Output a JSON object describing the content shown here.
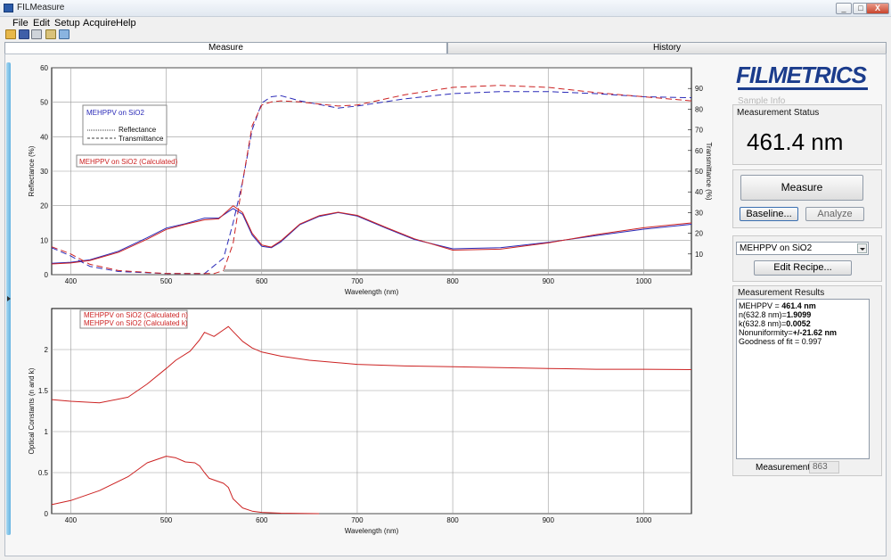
{
  "window": {
    "title": "FILMeasure",
    "btn_min": "_",
    "btn_max": "□",
    "btn_close": "X"
  },
  "menu": [
    "File",
    "Edit",
    "Setup",
    "Acquire",
    "Help"
  ],
  "toolbar_icons": [
    "open-folder-icon",
    "save-icon",
    "print-icon",
    "recipe-icon",
    "copy-icon"
  ],
  "tabs": {
    "measure": "Measure",
    "history": "History"
  },
  "brand": {
    "logo": "FILMETRICS",
    "color": "#1b3c8c"
  },
  "side": {
    "sample_info": "Sample Info",
    "status_label": "Measurement Status",
    "status_value": "461.4 nm",
    "measure_btn": "Measure",
    "baseline_btn": "Baseline...",
    "analyze_btn": "Analyze",
    "recipe_selected": "MEHPPV on SiO2",
    "edit_recipe_btn": "Edit Recipe...",
    "results_label": "Measurement Results",
    "results": {
      "l1a": "MEHPPV = ",
      "l1b": "461.4 nm",
      "l2a": " n(632.8 nm)=",
      "l2b": "1.9099",
      "l3a": " k(632.8 nm)=",
      "l3b": "0.0052",
      "l4a": " Nonuniformity=",
      "l4b": "+/-21.62 nm",
      "l5": " Goodness of fit = 0.997"
    },
    "meas_num_label": "Measurement #",
    "meas_num": "863"
  },
  "chart_data": [
    {
      "type": "line",
      "xlabel": "Wavelength (nm)",
      "ylabel": "Reflectance (%)",
      "y2label": "Transmittance (%)",
      "xlim": [
        380,
        1050
      ],
      "ylim": [
        0,
        60
      ],
      "y2lim": [
        0,
        100
      ],
      "xticks": [
        400,
        500,
        600,
        700,
        800,
        900,
        1000
      ],
      "yticks": [
        0,
        10,
        20,
        30,
        40,
        50,
        60
      ],
      "y2ticks": [
        10,
        20,
        30,
        40,
        50,
        60,
        70,
        80,
        90
      ],
      "legend": {
        "box1_title": "MEHPPV on SiO2",
        "box1_line1": "Reflectance",
        "box1_line2": "Transmittance",
        "box2_title": "MEHPPV on SiO2 (Calculated)"
      },
      "colors": {
        "measured": "#2a2ab8",
        "calculated": "#cc2222"
      },
      "series": [
        {
          "name": "Reflectance",
          "axis": "left",
          "style": "solid",
          "x": [
            380,
            400,
            420,
            450,
            480,
            500,
            520,
            540,
            555,
            570,
            580,
            590,
            600,
            610,
            620,
            640,
            660,
            680,
            700,
            730,
            760,
            800,
            850,
            900,
            950,
            1000,
            1050
          ],
          "y": [
            3.3,
            3.6,
            4.3,
            6.8,
            10.7,
            13.5,
            14.8,
            16.4,
            16.4,
            19.2,
            17.5,
            11.5,
            8.2,
            7.8,
            9.5,
            14.5,
            16.9,
            18,
            17,
            13.5,
            10.2,
            7.5,
            7.8,
            9.4,
            11.3,
            13.2,
            14.6
          ]
        },
        {
          "name": "Reflectance (Calculated)",
          "axis": "left",
          "style": "solid",
          "x": [
            380,
            400,
            420,
            450,
            480,
            500,
            520,
            540,
            555,
            570,
            580,
            590,
            600,
            610,
            620,
            640,
            660,
            680,
            700,
            730,
            760,
            800,
            850,
            900,
            950,
            1000,
            1050
          ],
          "y": [
            3.1,
            3.4,
            4.1,
            6.5,
            10.3,
            13.1,
            14.6,
            15.9,
            16.2,
            20,
            18,
            12,
            8.6,
            8,
            9.8,
            14.7,
            17.1,
            18.1,
            17.2,
            13.7,
            10.4,
            7.1,
            7.4,
            9.2,
            11.6,
            13.6,
            15
          ]
        },
        {
          "name": "Transmittance",
          "axis": "right",
          "style": "dashed",
          "x": [
            380,
            400,
            420,
            450,
            500,
            540,
            560,
            570,
            580,
            590,
            600,
            610,
            620,
            640,
            680,
            700,
            750,
            800,
            850,
            900,
            950,
            1000,
            1050
          ],
          "y": [
            13,
            9,
            4,
            1.5,
            0.5,
            0.5,
            8,
            25,
            45,
            70,
            83,
            86,
            86.5,
            84,
            80.5,
            81.5,
            85,
            87.5,
            88.5,
            88.5,
            87.5,
            86,
            85.5
          ]
        },
        {
          "name": "Transmittance (Calculated)",
          "axis": "right",
          "style": "dashed",
          "x": [
            380,
            400,
            420,
            450,
            500,
            550,
            560,
            570,
            580,
            590,
            600,
            610,
            620,
            640,
            680,
            700,
            750,
            800,
            850,
            900,
            950,
            1000,
            1050
          ],
          "y": [
            13.5,
            10,
            5,
            2,
            0.5,
            0.5,
            2,
            15,
            45,
            72,
            82,
            83.5,
            84,
            83.5,
            81.5,
            82,
            87,
            90.5,
            91.5,
            90.5,
            88,
            86,
            84
          ]
        },
        {
          "name": "Reference",
          "axis": "left",
          "style": "thick",
          "x": [
            560,
            1050
          ],
          "y": [
            1.2,
            1.2
          ]
        }
      ]
    },
    {
      "type": "line",
      "xlabel": "Wavelength (nm)",
      "ylabel": "Optical Constants (n and k)",
      "xlim": [
        380,
        1050
      ],
      "ylim": [
        0,
        2.5
      ],
      "xticks": [
        400,
        500,
        600,
        700,
        800,
        900,
        1000
      ],
      "yticks": [
        0,
        0.5,
        1,
        1.5,
        2
      ],
      "yticklabels": [
        "0",
        "0.5",
        "1",
        "1.5",
        "2"
      ],
      "legend": {
        "line1": "MEHPPV on SiO2 (Calculated n)",
        "line2": "MEHPPV on SiO2 (Calculated k)"
      },
      "colors": {
        "n": "#cc2222",
        "k": "#cc2222"
      },
      "series": [
        {
          "name": "MEHPPV on SiO2 (Calculated n)",
          "x": [
            380,
            400,
            430,
            460,
            480,
            500,
            510,
            525,
            535,
            540,
            550,
            560,
            565,
            570,
            580,
            590,
            600,
            620,
            650,
            700,
            750,
            800,
            850,
            900,
            950,
            1000,
            1050
          ],
          "y": [
            1.39,
            1.37,
            1.35,
            1.42,
            1.58,
            1.77,
            1.87,
            1.98,
            2.12,
            2.21,
            2.16,
            2.24,
            2.28,
            2.22,
            2.1,
            2.02,
            1.97,
            1.92,
            1.87,
            1.82,
            1.8,
            1.79,
            1.78,
            1.77,
            1.76,
            1.76,
            1.755
          ]
        },
        {
          "name": "MEHPPV on SiO2 (Calculated k)",
          "x": [
            380,
            400,
            430,
            460,
            480,
            500,
            510,
            520,
            530,
            535,
            540,
            545,
            555,
            560,
            565,
            570,
            580,
            590,
            600,
            620,
            660
          ],
          "y": [
            0.11,
            0.16,
            0.28,
            0.45,
            0.62,
            0.7,
            0.68,
            0.63,
            0.62,
            0.58,
            0.5,
            0.43,
            0.39,
            0.37,
            0.32,
            0.18,
            0.07,
            0.03,
            0.015,
            0.005,
            0
          ]
        }
      ]
    }
  ]
}
